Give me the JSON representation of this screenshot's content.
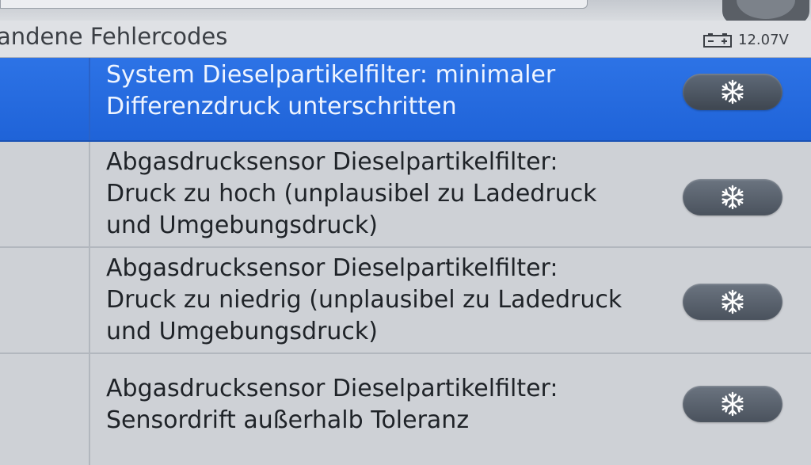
{
  "header": {
    "title": "andene Fehlercodes",
    "battery_icon": "battery-icon",
    "voltage": "12.07V"
  },
  "faults": [
    {
      "text": "System Dieselpartikelfilter: minimaler\nDifferenzdruck unterschritten",
      "selected": true,
      "action_icon": "snowflake-icon"
    },
    {
      "text": "Abgasdrucksensor Dieselpartikelfilter:\nDruck zu hoch (unplausibel zu Ladedruck\nund Umgebungsdruck)",
      "selected": false,
      "action_icon": "snowflake-icon"
    },
    {
      "text": "Abgasdrucksensor Dieselpartikelfilter:\nDruck zu niedrig (unplausibel zu Ladedruck\nund Umgebungsdruck)",
      "selected": false,
      "action_icon": "snowflake-icon"
    },
    {
      "text": "Abgasdrucksensor Dieselpartikelfilter:\nSensordrift außerhalb Toleranz",
      "selected": false,
      "action_icon": "snowflake-icon"
    }
  ],
  "colors": {
    "selected_row": "#1f63d8",
    "row_background": "#ced1d6",
    "freeze_button": "#4a525d"
  }
}
